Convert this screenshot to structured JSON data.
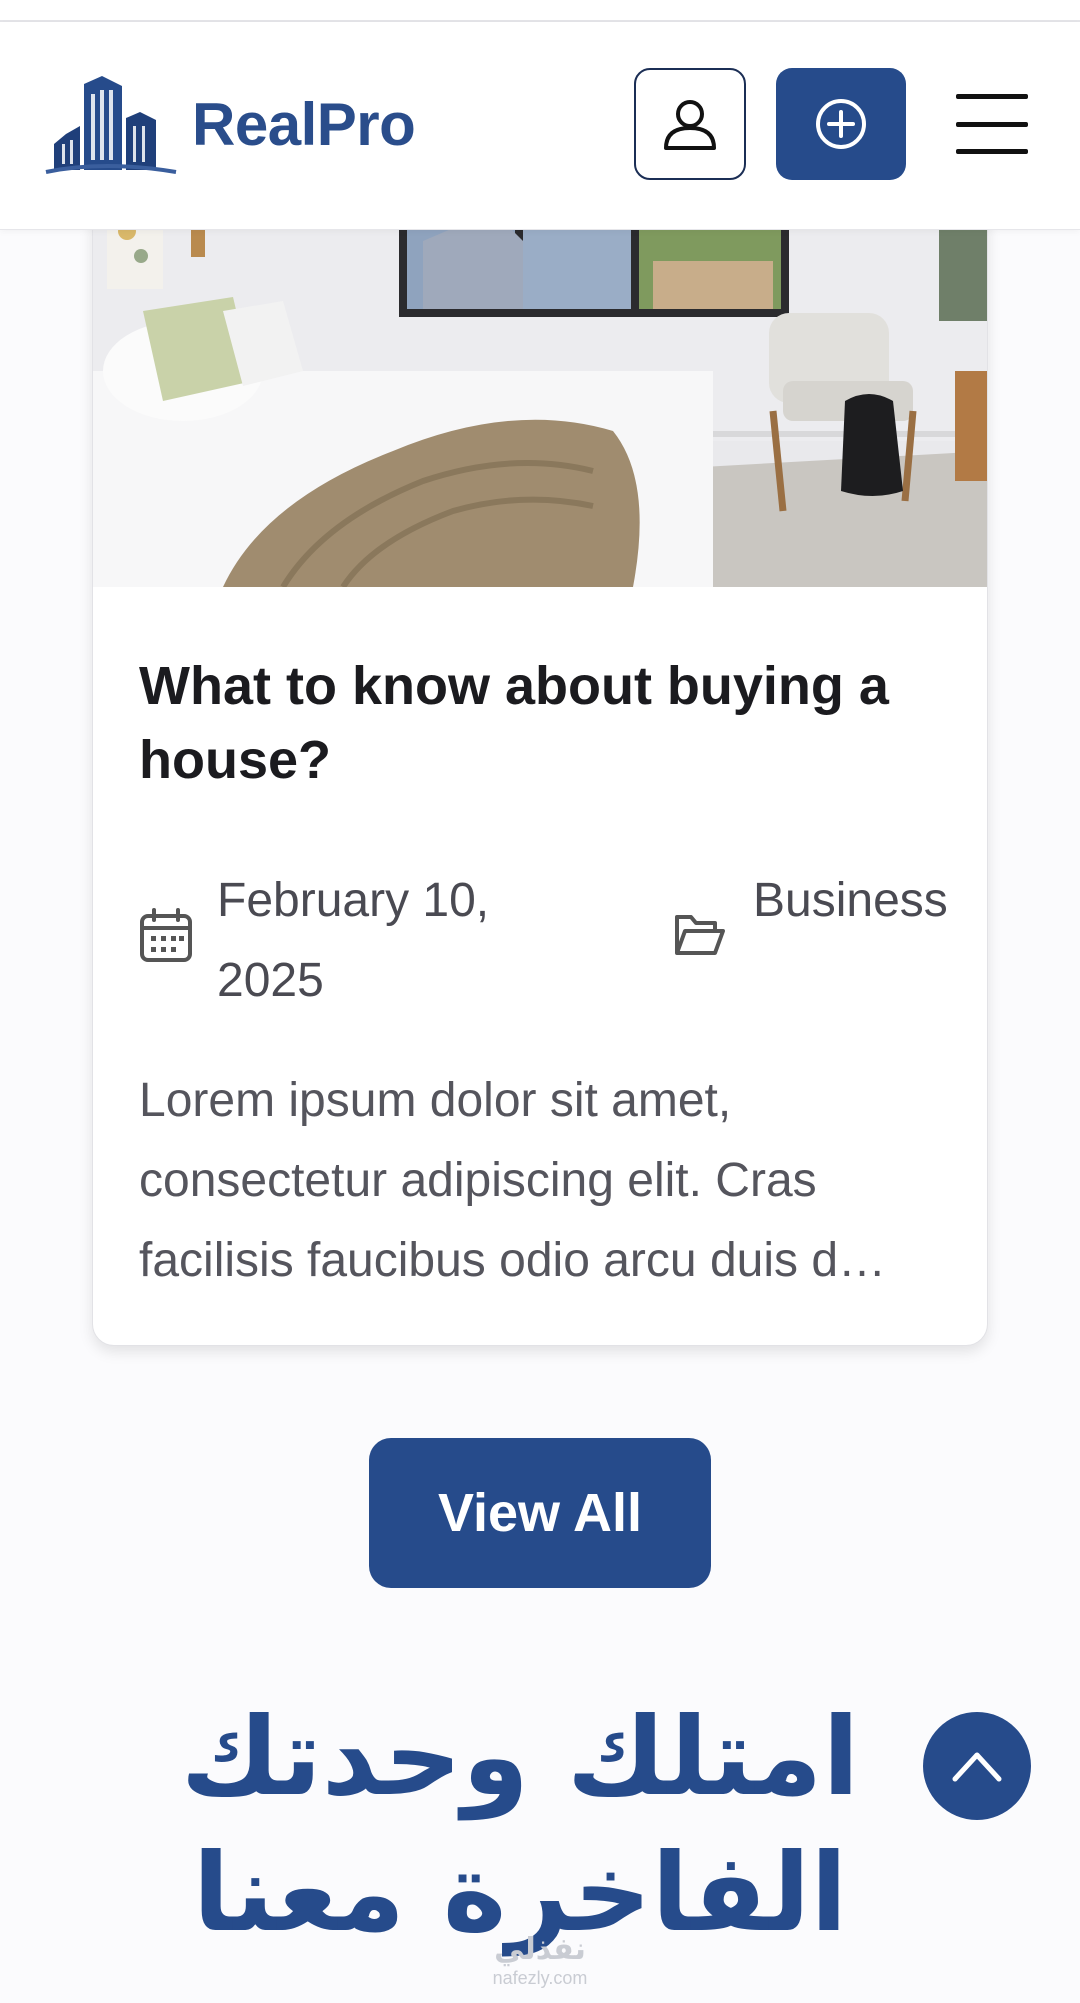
{
  "header": {
    "brand": "RealPro",
    "profile_icon": "user-icon",
    "add_icon": "plus-circle-icon",
    "menu_icon": "hamburger-menu-icon"
  },
  "card": {
    "image_alt": "bedroom photo",
    "title": "What to know about buying a house?",
    "date_icon": "calendar-icon",
    "date": "February 10, 2025",
    "category_icon": "folder-open-icon",
    "category": "Business",
    "excerpt": "Lorem ipsum dolor sit amet, consectetur adipiscing elit. Cras facilisis faucibus odio arcu duis d…"
  },
  "view_all_label": "View All",
  "headline": "امتلك وحدتك الفاخرة معنا",
  "scroll_top_icon": "chevron-up-icon",
  "watermark": {
    "arabic": "نفذلي",
    "latin": "nafezly.com"
  },
  "colors": {
    "primary": "#264b8b",
    "brand_text": "#2a4d8b",
    "title_text": "#1b1b1f",
    "body_text": "#55555d",
    "background": "#fbfbfd"
  }
}
